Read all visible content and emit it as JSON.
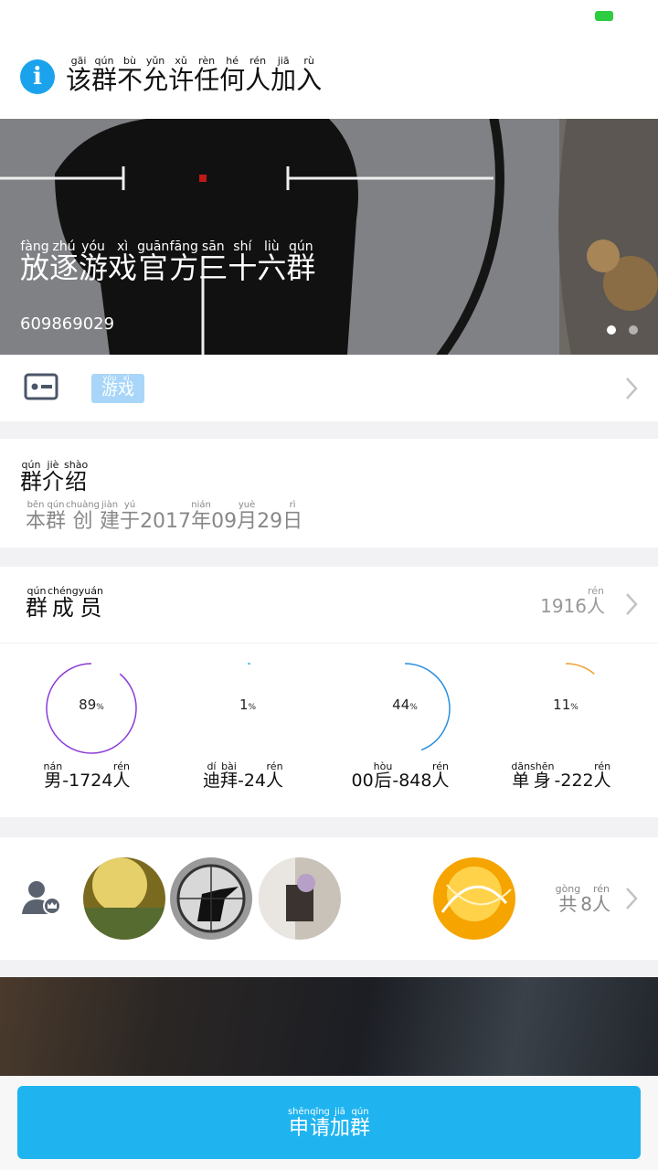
{
  "notice": {
    "icon": "info-icon",
    "chars": [
      {
        "py": "gāi",
        "hz": "该"
      },
      {
        "py": "qún",
        "hz": "群"
      },
      {
        "py": "bù",
        "hz": "不"
      },
      {
        "py": "yǔn",
        "hz": "允"
      },
      {
        "py": "xǔ",
        "hz": "许"
      },
      {
        "py": "rèn",
        "hz": "任"
      },
      {
        "py": "hé",
        "hz": "何"
      },
      {
        "py": "rén",
        "hz": "人"
      },
      {
        "py": "jiā",
        "hz": "加"
      },
      {
        "py": "rù",
        "hz": "入"
      }
    ]
  },
  "banner": {
    "title_chars": [
      {
        "py": "fàng",
        "hz": "放"
      },
      {
        "py": "zhú",
        "hz": "逐"
      },
      {
        "py": "yóu",
        "hz": "游"
      },
      {
        "py": "xì",
        "hz": "戏"
      },
      {
        "py": "guān",
        "hz": "官"
      },
      {
        "py": "fāng",
        "hz": "方"
      },
      {
        "py": "sān",
        "hz": "三"
      },
      {
        "py": "shí",
        "hz": "十"
      },
      {
        "py": "liù",
        "hz": "六"
      },
      {
        "py": "qún",
        "hz": "群"
      }
    ],
    "group_id": "609869029"
  },
  "category": {
    "icon": "id-card-icon",
    "tag_chars": [
      {
        "py": "yóu",
        "hz": "游"
      },
      {
        "py": "xì",
        "hz": "戏"
      }
    ]
  },
  "intro": {
    "title_chars": [
      {
        "py": "qún",
        "hz": "群"
      },
      {
        "py": "jiè",
        "hz": "介"
      },
      {
        "py": "shào",
        "hz": "绍"
      }
    ],
    "date_chars": [
      {
        "py": "běn",
        "hz": "本"
      },
      {
        "py": "qún",
        "hz": "群"
      },
      {
        "py": "chuàng",
        "hz": "创"
      },
      {
        "py": "jiàn",
        "hz": "建"
      },
      {
        "py": "yú",
        "hz": "于"
      },
      {
        "py": "",
        "hz": "2017"
      },
      {
        "py": "nián",
        "hz": "年"
      },
      {
        "py": "",
        "hz": "09"
      },
      {
        "py": "yuè",
        "hz": "月"
      },
      {
        "py": "",
        "hz": "29"
      },
      {
        "py": "rì",
        "hz": "日"
      }
    ]
  },
  "members": {
    "title_chars": [
      {
        "py": "qún",
        "hz": "群"
      },
      {
        "py": "chéng",
        "hz": "成"
      },
      {
        "py": "yuán",
        "hz": "员"
      }
    ],
    "count_chars": [
      {
        "py": "",
        "hz": "1916"
      },
      {
        "py": "rén",
        "hz": "人"
      }
    ]
  },
  "stats": [
    {
      "percent": 89,
      "color": "#8a3cd6",
      "label_chars": [
        {
          "py": "nán",
          "hz": "男"
        },
        {
          "py": "",
          "hz": "-1724"
        },
        {
          "py": "rén",
          "hz": "人"
        }
      ]
    },
    {
      "percent": 1,
      "color": "#3cb4e6",
      "label_chars": [
        {
          "py": "dí",
          "hz": "迪"
        },
        {
          "py": "bài",
          "hz": "拜"
        },
        {
          "py": "",
          "hz": "-24"
        },
        {
          "py": "rén",
          "hz": "人"
        }
      ]
    },
    {
      "percent": 44,
      "color": "#2a8fe0",
      "label_chars": [
        {
          "py": "",
          "hz": "00"
        },
        {
          "py": "hòu",
          "hz": "后"
        },
        {
          "py": "",
          "hz": "-848"
        },
        {
          "py": "rén",
          "hz": "人"
        }
      ]
    },
    {
      "percent": 11,
      "color": "#f0a030",
      "label_chars": [
        {
          "py": "dān",
          "hz": "单"
        },
        {
          "py": "shēn",
          "hz": "身"
        },
        {
          "py": "",
          "hz": "-222"
        },
        {
          "py": "rén",
          "hz": "人"
        }
      ]
    }
  ],
  "admins": {
    "icon": "admin-crown-icon",
    "count_chars": [
      {
        "py": "gòng",
        "hz": "共"
      },
      {
        "py": "",
        "hz": "8"
      },
      {
        "py": "rén",
        "hz": "人"
      }
    ]
  },
  "footer": {
    "button_chars": [
      {
        "py": "shēn",
        "hz": "申"
      },
      {
        "py": "qǐng",
        "hz": "请"
      },
      {
        "py": "jiā",
        "hz": "加"
      },
      {
        "py": "qún",
        "hz": "群"
      }
    ]
  }
}
